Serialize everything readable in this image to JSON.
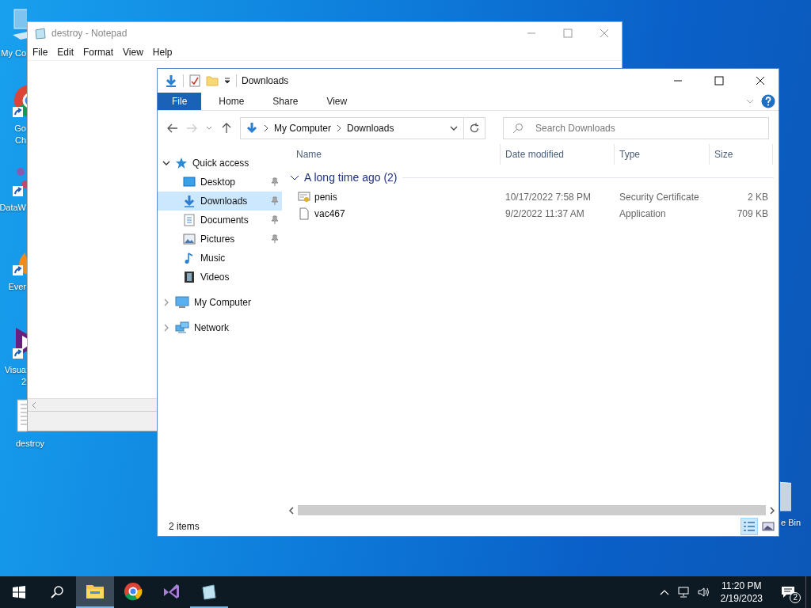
{
  "desktop": {
    "icons": [
      {
        "kind": "computer",
        "shortcut": false,
        "lines": [
          "My Co"
        ]
      },
      {
        "kind": "chrome",
        "shortcut": true,
        "lines": [
          "Go",
          "Ch"
        ]
      },
      {
        "kind": "dots",
        "shortcut": true,
        "lines": [
          "DataW"
        ]
      },
      {
        "kind": "flame",
        "shortcut": true,
        "lines": [
          "Ever"
        ]
      },
      {
        "kind": "vs",
        "shortcut": true,
        "lines": [
          "Visua",
          "2"
        ]
      },
      {
        "kind": "textfile",
        "shortcut": false,
        "lines": [
          "destroy"
        ]
      },
      {
        "kind": "bin",
        "shortcut": false,
        "lines": [
          "e Bin"
        ]
      }
    ]
  },
  "notepad": {
    "title": "destroy - Notepad",
    "menu": [
      "File",
      "Edit",
      "Format",
      "View",
      "Help"
    ]
  },
  "explorer": {
    "title": "Downloads",
    "ribbon_tabs": [
      {
        "label": "File",
        "selected": true
      },
      {
        "label": "Home",
        "selected": false
      },
      {
        "label": "Share",
        "selected": false
      },
      {
        "label": "View",
        "selected": false
      }
    ],
    "breadcrumb": [
      "My Computer",
      "Downloads"
    ],
    "search": {
      "placeholder": "Search Downloads"
    },
    "nav": [
      {
        "label": "Quick access",
        "kind": "star",
        "expanded": true,
        "selected": false,
        "children": [
          {
            "label": "Desktop",
            "kind": "desktop",
            "pinned": true,
            "selected": false
          },
          {
            "label": "Downloads",
            "kind": "downloads",
            "pinned": true,
            "selected": true
          },
          {
            "label": "Documents",
            "kind": "documents",
            "pinned": true,
            "selected": false
          },
          {
            "label": "Pictures",
            "kind": "pictures",
            "pinned": true,
            "selected": false
          },
          {
            "label": "Music",
            "kind": "music",
            "pinned": false,
            "selected": false
          },
          {
            "label": "Videos",
            "kind": "videos",
            "pinned": false,
            "selected": false
          }
        ]
      },
      {
        "label": "My Computer",
        "kind": "computer",
        "expanded": false,
        "selected": false
      },
      {
        "label": "Network",
        "kind": "network",
        "expanded": false,
        "selected": false
      }
    ],
    "columns": [
      "Name",
      "Date modified",
      "Type",
      "Size"
    ],
    "group": {
      "label": "A long time ago (2)",
      "expanded": true
    },
    "rows": [
      {
        "kind": "certificate",
        "name": "penis",
        "date": "10/17/2022 7:58 PM",
        "type": "Security Certificate",
        "size": "2 KB"
      },
      {
        "kind": "file",
        "name": "vac467",
        "date": "9/2/2022 11:37 AM",
        "type": "Application",
        "size": "709 KB"
      }
    ],
    "status": "2 items",
    "view_buttons": [
      {
        "kind": "details",
        "selected": true
      },
      {
        "kind": "tiles",
        "selected": false
      }
    ]
  },
  "taskbar": {
    "items": [
      {
        "kind": "explorer",
        "active": true,
        "running": true
      },
      {
        "kind": "chrome",
        "active": false,
        "running": false
      },
      {
        "kind": "vs",
        "active": false,
        "running": false
      },
      {
        "kind": "notepad",
        "active": false,
        "running": true
      }
    ],
    "time": "11:20 PM",
    "date": "2/19/2023",
    "notifications": "2"
  }
}
